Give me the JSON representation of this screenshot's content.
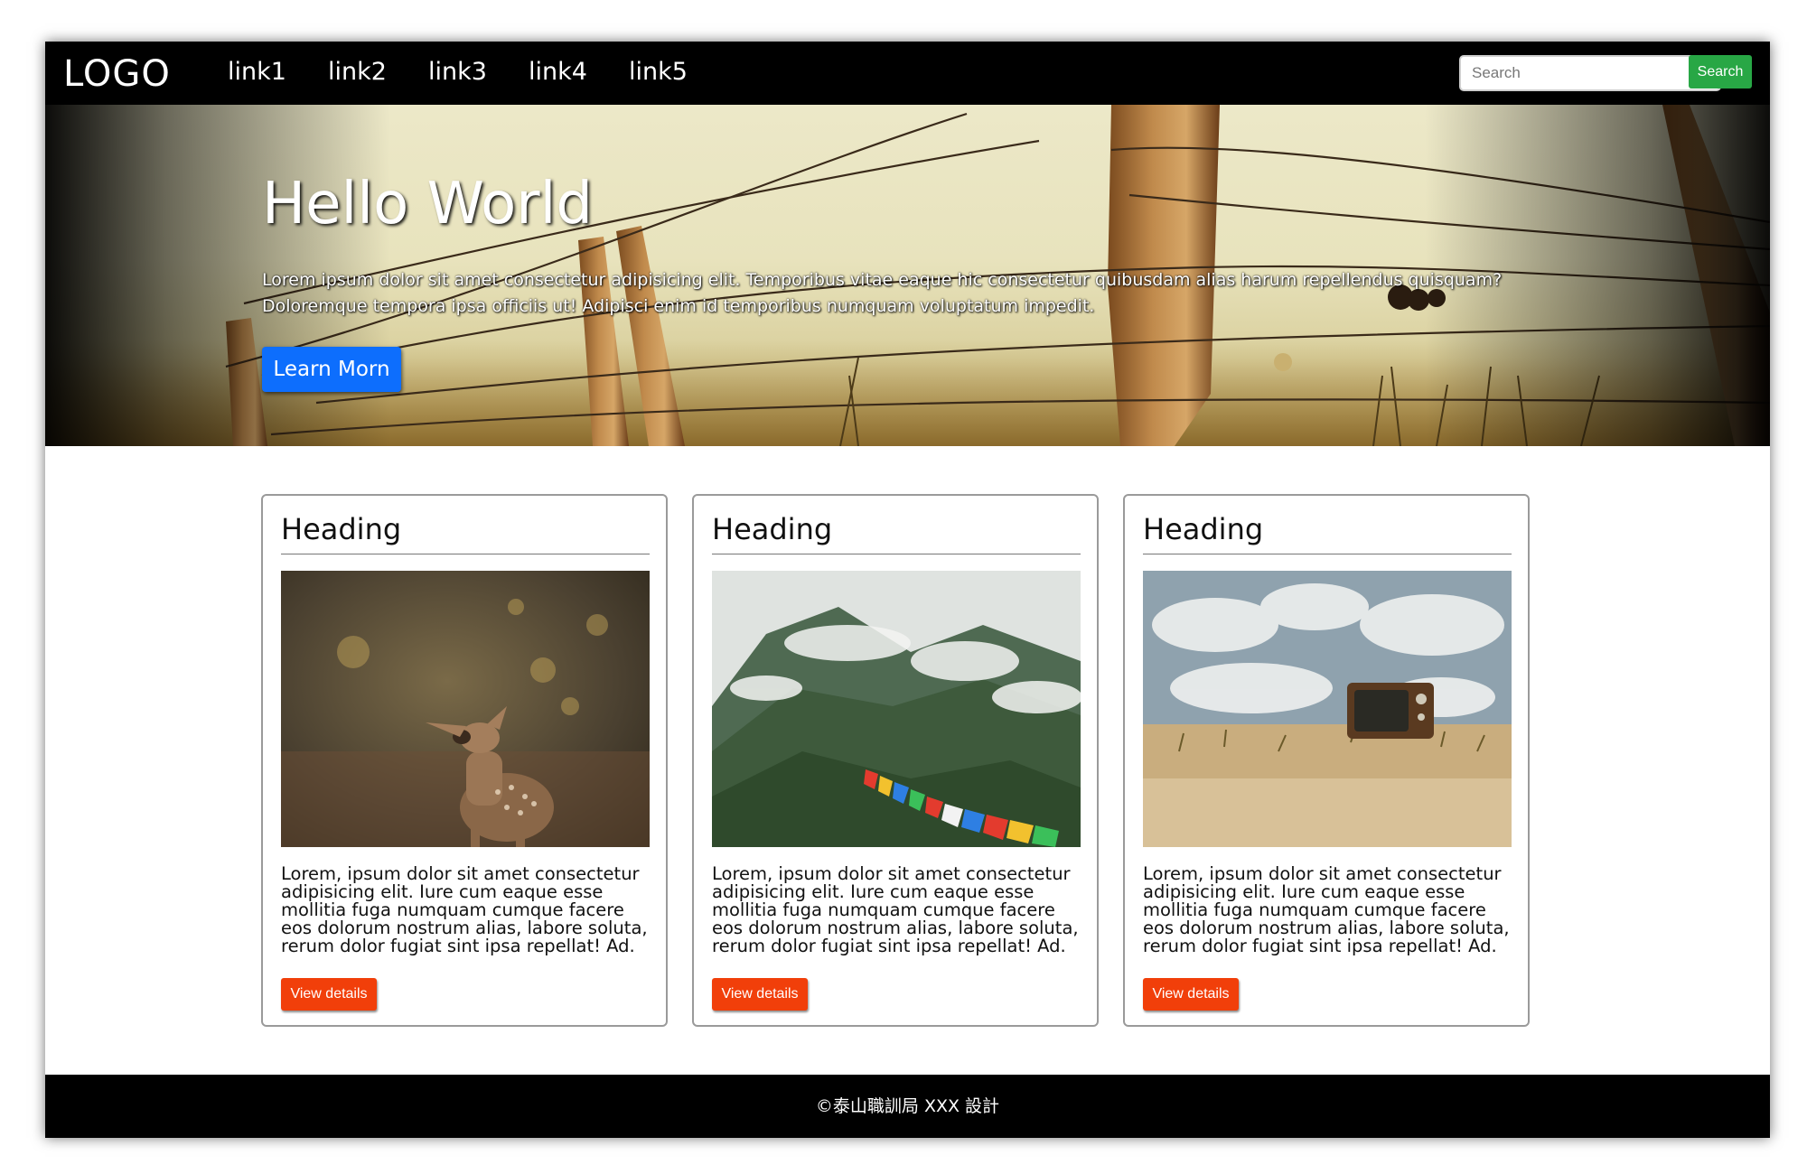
{
  "colors": {
    "navbar_bg": "#000000",
    "search_button": "#28a745",
    "hero_button": "#0d6efd",
    "card_button": "#f13f0a",
    "footer_bg": "#000000"
  },
  "navbar": {
    "logo": "LOGO",
    "links": [
      "link1",
      "link2",
      "link3",
      "link4",
      "link5"
    ],
    "search_placeholder": "Search",
    "search_button": "Search"
  },
  "hero": {
    "image": "barbed-wire-fence-photo",
    "title": "Hello World",
    "text": "Lorem ipsum dolor sit amet consectetur adipisicing elit. Temporibus vitae eaque hic consectetur quibusdam alias harum repellendus quisquam? Doloremque tempora ipsa officiis ut! Adipisci enim id temporibus numquam voluptatum impedit.",
    "button": "Learn Morn"
  },
  "cards": [
    {
      "heading": "Heading",
      "image": "deer-in-forest-photo",
      "text": "Lorem, ipsum dolor sit amet consectetur adipisicing elit. Iure cum eaque esse mollitia fuga numquam cumque facere eos dolorum nostrum alias, labore soluta, rerum dolor fugiat sint ipsa repellat! Ad.",
      "button": "View details"
    },
    {
      "heading": "Heading",
      "image": "misty-mountains-prayer-flags-photo",
      "text": "Lorem, ipsum dolor sit amet consectetur adipisicing elit. Iure cum eaque esse mollitia fuga numquam cumque facere eos dolorum nostrum alias, labore soluta, rerum dolor fugiat sint ipsa repellat! Ad.",
      "button": "View details"
    },
    {
      "heading": "Heading",
      "image": "old-tv-on-sand-photo",
      "text": "Lorem, ipsum dolor sit amet consectetur adipisicing elit. Iure cum eaque esse mollitia fuga numquam cumque facere eos dolorum nostrum alias, labore soluta, rerum dolor fugiat sint ipsa repellat! Ad.",
      "button": "View details"
    }
  ],
  "footer": {
    "text": "©泰山職訓局 XXX 設計"
  }
}
